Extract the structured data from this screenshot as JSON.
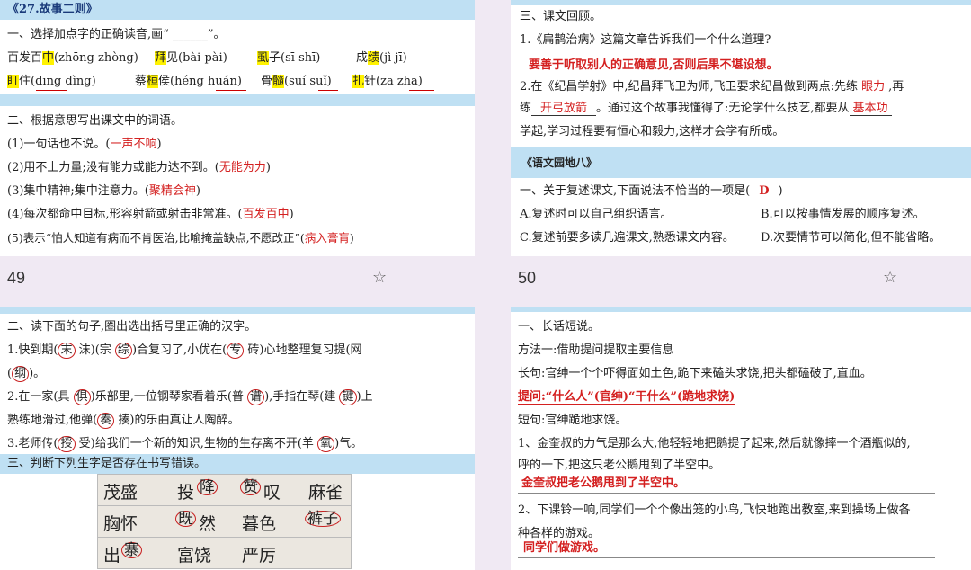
{
  "page_numbers": {
    "left": "49",
    "right": "50"
  },
  "slide49": {
    "title": "《27.故事二则》",
    "q1_title": "一、选择加点字的正确读音,画“ ______”。",
    "q1_row1": [
      {
        "pre": "百发百",
        "char": "中",
        "opts": "(zhōng zhòng)"
      },
      {
        "pre": "",
        "char": "拜",
        "post": "见",
        "opts": "(bài  pài)"
      },
      {
        "pre": "",
        "char": "虱",
        "post": "子",
        "opts": "(sī  shī)"
      },
      {
        "pre": "成",
        "char": "绩",
        "opts": "(jì  jī)"
      }
    ],
    "q1_row2": [
      {
        "pre": "",
        "char": "盯",
        "post": "住",
        "opts": "(dīng  dìng)"
      },
      {
        "pre": "蔡",
        "char": "桓",
        "post": "侯",
        "opts": "(héng huán)"
      },
      {
        "pre": "骨",
        "char": "髓",
        "opts": "(suí  suǐ)"
      },
      {
        "pre": "",
        "char": "扎",
        "post": "针",
        "opts": "(zā  zhā)"
      }
    ],
    "q2_title": "二、根据意思写出课文中的词语。",
    "q2_items": [
      {
        "text": "(1)一句话也不说。(",
        "answer": "一声不响",
        "close": ")"
      },
      {
        "text": "(2)用不上力量;没有能力或能力达不到。(",
        "answer": "无能为力",
        "close": ")"
      },
      {
        "text": "(3)集中精神;集中注意力。(",
        "answer": "聚精会神",
        "close": ")"
      },
      {
        "text": "(4)每次都命中目标,形容射箭或射击非常准。(",
        "answer": "百发百中",
        "close": ")"
      },
      {
        "text": "(5)表示“怕人知道有病而不肯医治,比喻掩盖缺点,不愿改正”(",
        "answer": "病入膏肓",
        "close": ")"
      }
    ]
  },
  "slide50": {
    "review_title": "三、课文回顾。",
    "q1": "1.《扁鹊治病》这篇文章告诉我们一个什么道理?",
    "q1_answer": "要善于听取别人的正确意见,否则后果不堪设想。",
    "q2_line1": "2.在《纪昌学射》中,纪昌拜飞卫为师,飞卫要求纪昌做到两点:先练",
    "q2_blank1": "眼力",
    "q2_line1_end": ",再",
    "q2_line2_pre": "练",
    "q2_blank2": "开弓放箭",
    "q2_line2_mid": "。通过这个故事我懂得了:无论学什么技艺,都要从",
    "q2_blank3": "基本功",
    "q2_line3": "学起,学习过程要有恒心和毅力,这样才会学有所成。",
    "garden_title": "《语文园地八》",
    "q_garden": "一、关于复述课文,下面说法不恰当的一项是(",
    "q_garden_answer": "D",
    "q_garden_close": ")",
    "options": [
      "A.复述时可以自己组织语言。",
      "B.可以按事情发展的顺序复述。",
      "C.复述前要多读几遍课文,熟悉课文内容。",
      "D.次要情节可以简化,但不能省略。"
    ]
  },
  "slide51": {
    "q2_title": "二、读下面的句子,圈出选出括号里正确的汉字。",
    "s1a": "1.快到期",
    "s1_c1": "末",
    "s1b": " 沫)(宗 ",
    "s1_c2": "综",
    "s1c": ")合复习了,小优在(",
    "s1_c3": "专",
    "s1d": "  砖)心地整理复习提(网",
    "s1_c4": "纲",
    "s1e": ")。",
    "s2a": "2.在一家(具  ",
    "s2_c1": "俱",
    "s2b": ")乐部里,一位钢琴家看着乐(普  ",
    "s2_c2": "谱",
    "s2c": "),手指在琴(建  ",
    "s2_c3": "键",
    "s2d": ")上",
    "s2e": "熟练地滑过,他弹(",
    "s2_c4": "奏",
    "s2f": "  揍)的乐曲真让人陶醉。",
    "s3a": "3.老师传(",
    "s3_c1": "授",
    "s3b": "  受)给我们一个新的知识,生物的生存离不开(羊  ",
    "s3_c2": "氧",
    "s3c": ")气。",
    "q3_title": "三、判断下列生字是否存在书写错误。",
    "grid_rows": [
      [
        "茂盛",
        "投",
        "降",
        "赞",
        "叹",
        "麻雀"
      ],
      [
        "胸怀",
        "",
        "既",
        "然",
        "暮色",
        "裤子"
      ],
      [
        "出",
        "寨",
        "富饶",
        "严厉"
      ]
    ]
  },
  "slide52": {
    "title": "一、长话短说。",
    "method": "方法一:借助提问提取主要信息",
    "long_label": "长句:",
    "long_text": "官绅一个个吓得面如土色,跪下来磕头求饶,把头都磕破了,直血。",
    "hint": "提问:“什么人”(官绅)“干什么”(跪地求饶)",
    "short_label": "短句:",
    "short_text": "官绅跪地求饶。",
    "q1_line1": "1、金奎叔的力气是那么大,他轻轻地把鹅提了起来,然后就像摔一个酒瓶似的,",
    "q1_line2": "呼的一下,把这只老公鹅甩到了半空中。",
    "q1_answer": "金奎叔把老公鹅甩到了半空中。",
    "q2_line1": "2、下课铃一响,同学们一个个像出笼的小鸟,飞快地跑出教室,来到操场上做各",
    "q2_line2": "种各样的游戏。",
    "q2_answer": "同学们做游戏。"
  }
}
